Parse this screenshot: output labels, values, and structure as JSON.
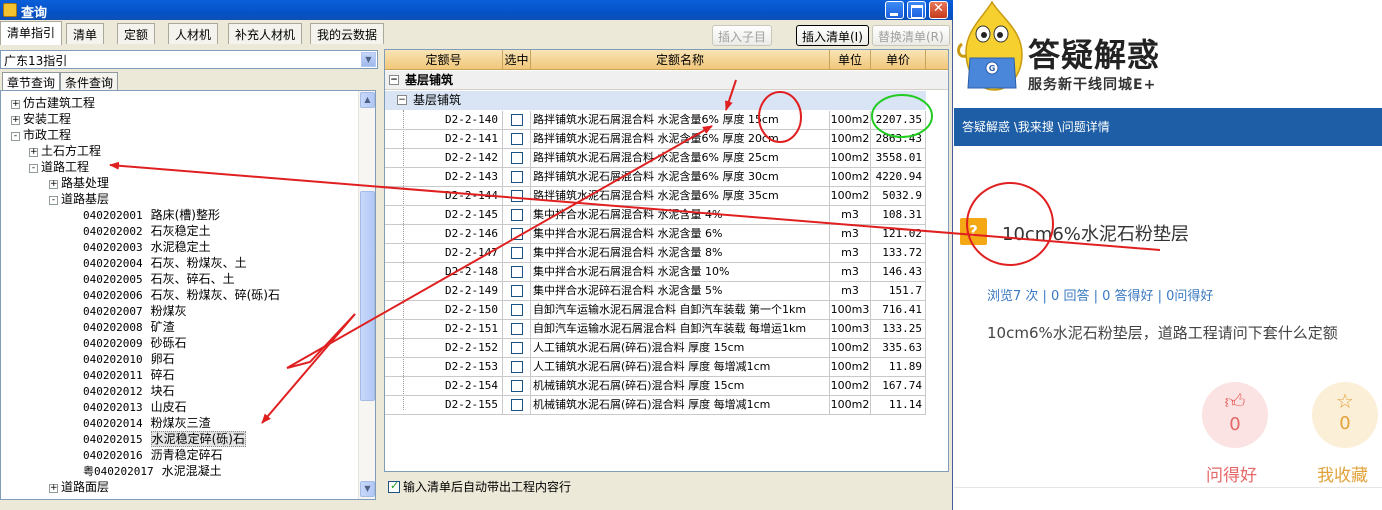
{
  "window": {
    "title": "查询",
    "tabs": [
      "清单指引",
      "清单",
      "定额",
      "人材机",
      "补充人材机",
      "我的云数据"
    ],
    "buttons": {
      "insert_child": "插入子目",
      "insert_list": "插入清单(I)",
      "replace_list": "替换清单(R)"
    },
    "combo_value": "广东13指引",
    "subtabs": [
      "章节查询",
      "条件查询"
    ],
    "bottom_checkbox": "输入清单后自动带出工程内容行"
  },
  "tree": [
    {
      "label": "仿古建筑工程",
      "box": "+"
    },
    {
      "label": "安装工程",
      "box": "+"
    },
    {
      "label": "市政工程",
      "box": "-"
    },
    {
      "label": "土石方工程",
      "box": "+"
    },
    {
      "label": "道路工程",
      "box": "-"
    },
    {
      "label": "路基处理",
      "box": "+"
    },
    {
      "label": "道路基层",
      "box": "-"
    },
    {
      "code": "040202001",
      "label": "路床(槽)整形"
    },
    {
      "code": "040202002",
      "label": "石灰稳定土"
    },
    {
      "code": "040202003",
      "label": "水泥稳定土"
    },
    {
      "code": "040202004",
      "label": "石灰、粉煤灰、土"
    },
    {
      "code": "040202005",
      "label": "石灰、碎石、土"
    },
    {
      "code": "040202006",
      "label": "石灰、粉煤灰、碎(砾)石"
    },
    {
      "code": "040202007",
      "label": "粉煤灰"
    },
    {
      "code": "040202008",
      "label": "矿渣"
    },
    {
      "code": "040202009",
      "label": "砂砾石"
    },
    {
      "code": "040202010",
      "label": "卵石"
    },
    {
      "code": "040202011",
      "label": "碎石"
    },
    {
      "code": "040202012",
      "label": "块石"
    },
    {
      "code": "040202013",
      "label": "山皮石"
    },
    {
      "code": "040202014",
      "label": "粉煤灰三渣"
    },
    {
      "code": "040202015",
      "label": "水泥稳定碎(砾)石"
    },
    {
      "code": "040202016",
      "label": "沥青稳定碎石"
    },
    {
      "code": "粤040202017",
      "label": "水泥混凝土"
    },
    {
      "label": "道路面层",
      "box": "+"
    }
  ],
  "grid": {
    "headers": [
      "定额号",
      "选中",
      "定额名称",
      "单位",
      "单价"
    ],
    "group1": "基层铺筑",
    "group2": "基层铺筑",
    "rows": [
      {
        "code": "D2-2-140",
        "name": "路拌铺筑水泥石屑混合料 水泥含量6% 厚度 15cm",
        "unit": "100m2",
        "price": "2207.35"
      },
      {
        "code": "D2-2-141",
        "name": "路拌铺筑水泥石屑混合料 水泥含量6% 厚度 20cm",
        "unit": "100m2",
        "price": "2863.43"
      },
      {
        "code": "D2-2-142",
        "name": "路拌铺筑水泥石屑混合料 水泥含量6% 厚度 25cm",
        "unit": "100m2",
        "price": "3558.01"
      },
      {
        "code": "D2-2-143",
        "name": "路拌铺筑水泥石屑混合料 水泥含量6% 厚度 30cm",
        "unit": "100m2",
        "price": "4220.94"
      },
      {
        "code": "D2-2-144",
        "name": "路拌铺筑水泥石屑混合料 水泥含量6% 厚度 35cm",
        "unit": "100m2",
        "price": "5032.9"
      },
      {
        "code": "D2-2-145",
        "name": "集中拌合水泥石屑混合料 水泥含量 4%",
        "unit": "m3",
        "price": "108.31"
      },
      {
        "code": "D2-2-146",
        "name": "集中拌合水泥石屑混合料 水泥含量 6%",
        "unit": "m3",
        "price": "121.02"
      },
      {
        "code": "D2-2-147",
        "name": "集中拌合水泥石屑混合料 水泥含量 8%",
        "unit": "m3",
        "price": "133.72"
      },
      {
        "code": "D2-2-148",
        "name": "集中拌合水泥石屑混合料 水泥含量 10%",
        "unit": "m3",
        "price": "146.43"
      },
      {
        "code": "D2-2-149",
        "name": "集中拌合水泥碎石混合料 水泥含量 5%",
        "unit": "m3",
        "price": "151.7"
      },
      {
        "code": "D2-2-150",
        "name": "自卸汽车运输水泥石屑混合料 自卸汽车装载 第一个1km",
        "unit": "100m3",
        "price": "716.41"
      },
      {
        "code": "D2-2-151",
        "name": "自卸汽车运输水泥石屑混合料 自卸汽车装载 每增运1km",
        "unit": "100m3",
        "price": "133.25"
      },
      {
        "code": "D2-2-152",
        "name": "人工铺筑水泥石屑(碎石)混合料 厚度 15cm",
        "unit": "100m2",
        "price": "335.63"
      },
      {
        "code": "D2-2-153",
        "name": "人工铺筑水泥石屑(碎石)混合料 厚度 每增减1cm",
        "unit": "100m2",
        "price": "11.89"
      },
      {
        "code": "D2-2-154",
        "name": "机械铺筑水泥石屑(碎石)混合料 厚度 15cm",
        "unit": "100m2",
        "price": "167.74"
      },
      {
        "code": "D2-2-155",
        "name": "机械铺筑水泥石屑(碎石)混合料 厚度 每增减1cm",
        "unit": "100m2",
        "price": "11.14"
      }
    ]
  },
  "web": {
    "brand_title": "答疑解惑",
    "brand_sub": "服务新干线同城E+",
    "breadcrumb": "答疑解惑 \\我来搜 \\问题详情",
    "question_title": "10cm6%水泥石粉垫层",
    "meta": "浏览7 次 | 0 回答 | 0 答得好 | 0问得好",
    "question_body": "10cm6%水泥石粉垫层，道路工程请问下套什么定额",
    "ask_good_count": "0",
    "ask_good_label": "问得好",
    "fav_count": "0",
    "fav_label": "我收藏"
  },
  "colors": {
    "annotation_red": "#e02020",
    "annotation_green": "#22cc22",
    "navbar_blue": "#1d5ea6"
  }
}
